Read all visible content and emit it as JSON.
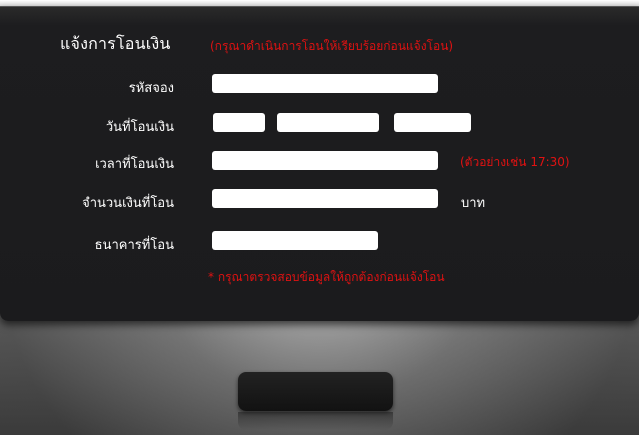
{
  "form": {
    "title": "แจ้งการโอนเงิน",
    "subtitle": "(กรุณาดำเนินการโอนให้เรียบร้อยก่อนแจ้งโอน)",
    "fields": {
      "booking_code": {
        "label": "รหัสจอง",
        "value": ""
      },
      "transfer_date": {
        "label": "วันที่โอนเงิน",
        "day": "",
        "month": "",
        "year": ""
      },
      "transfer_time": {
        "label": "เวลาที่โอนเงิน",
        "value": "",
        "hint": "(ตัวอย่างเช่น 17:30)"
      },
      "amount": {
        "label": "จำนวนเงินที่โอน",
        "value": "",
        "unit": "บาท"
      },
      "bank": {
        "label": "ธนาคารที่โอน",
        "value": ""
      }
    },
    "note": "* กรุณาตรวจสอบข้อมูลให้ถูกต้องก่อนแจ้งโอน"
  },
  "submit_button": {
    "label": ""
  }
}
